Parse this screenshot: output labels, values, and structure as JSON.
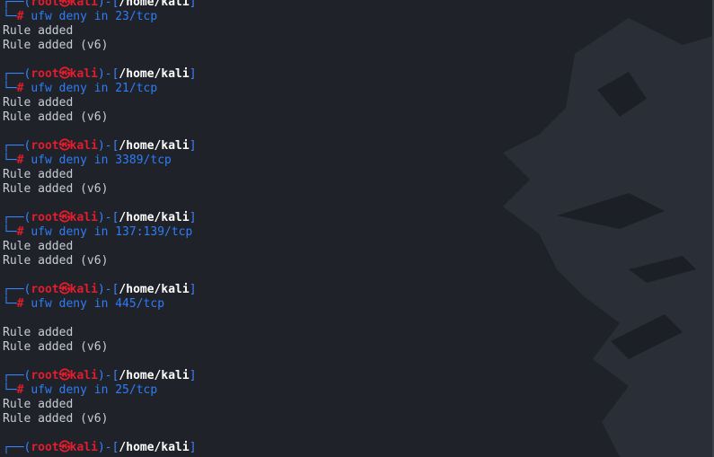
{
  "prompt": {
    "user": "root",
    "at_symbol": "㉿",
    "host": "kali",
    "path": "/home/kali",
    "symbol": "#"
  },
  "blocks": [
    {
      "command": "ufw deny in 23/tcp",
      "blank_before_output": false,
      "output": [
        "Rule added",
        "Rule added (v6)"
      ]
    },
    {
      "command": "ufw deny in 21/tcp",
      "blank_before_output": false,
      "output": [
        "Rule added",
        "Rule added (v6)"
      ]
    },
    {
      "command": "ufw deny in 3389/tcp",
      "blank_before_output": false,
      "output": [
        "Rule added",
        "Rule added (v6)"
      ]
    },
    {
      "command": "ufw deny in 137:139/tcp",
      "blank_before_output": false,
      "output": [
        "Rule added",
        "Rule added (v6)"
      ]
    },
    {
      "command": "ufw deny in 445/tcp",
      "blank_before_output": true,
      "output": [
        "Rule added",
        "Rule added (v6)"
      ]
    },
    {
      "command": "ufw deny in 25/tcp",
      "blank_before_output": false,
      "output": [
        "Rule added",
        "Rule added (v6)"
      ]
    },
    {
      "command": null,
      "blank_before_output": false,
      "output": []
    }
  ],
  "colors": {
    "background": "#1f2229",
    "prompt_frame": "#3b82f6",
    "user_host": "#e11d2e",
    "path": "#ffffff",
    "command": "#2f7df6",
    "output": "#c7ccd3"
  }
}
